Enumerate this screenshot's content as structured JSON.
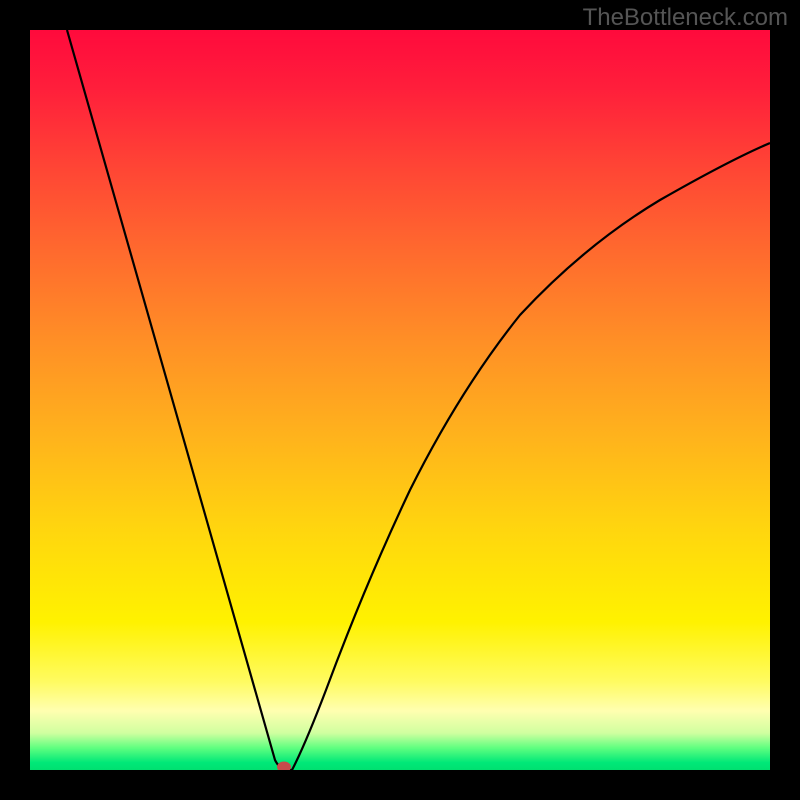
{
  "watermark": "TheBottleneck.com",
  "chart_data": {
    "type": "line",
    "title": "",
    "xlabel": "",
    "ylabel": "",
    "xlim": [
      0,
      100
    ],
    "ylim": [
      0,
      100
    ],
    "background_gradient": {
      "direction": "vertical",
      "stops": [
        {
          "pos": 0,
          "color": "#ff0a3c",
          "meaning": "high"
        },
        {
          "pos": 50,
          "color": "#ffb31c",
          "meaning": "mid"
        },
        {
          "pos": 88,
          "color": "#fff200",
          "meaning": "low-mid"
        },
        {
          "pos": 100,
          "color": "#00e070",
          "meaning": "low"
        }
      ]
    },
    "series": [
      {
        "name": "bottleneck-curve",
        "x": [
          5,
          10,
          15,
          20,
          25,
          30,
          33,
          35,
          40,
          45,
          50,
          55,
          60,
          65,
          70,
          75,
          80,
          85,
          90,
          95,
          100
        ],
        "y": [
          100,
          82,
          64,
          47,
          29,
          11,
          0,
          0,
          15,
          30,
          42,
          52,
          60,
          66,
          71,
          75,
          78,
          80,
          82,
          84,
          85
        ]
      }
    ],
    "annotations": [
      {
        "type": "marker",
        "x": 34,
        "y": 0,
        "color": "#c94b4b",
        "name": "optimum-point"
      }
    ]
  }
}
